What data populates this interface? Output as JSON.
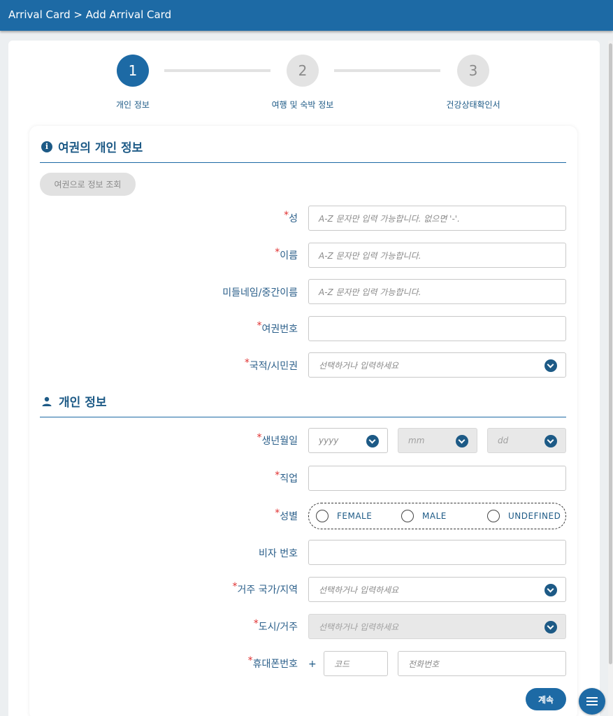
{
  "header": {
    "breadcrumb": "Arrival Card > Add Arrival Card"
  },
  "stepper": {
    "steps": [
      {
        "number": "1",
        "label": "개인 정보",
        "active": true
      },
      {
        "number": "2",
        "label": "여행 및 숙박 정보",
        "active": false
      },
      {
        "number": "3",
        "label": "건강상태확인서",
        "active": false
      }
    ]
  },
  "passport_section": {
    "title": "여권의 개인 정보",
    "icon": "info-icon",
    "lookup_button": "여권으로 정보 조회",
    "fields": {
      "surname": {
        "label": "성",
        "placeholder": "A-Z 문자만 입력 가능합니다. 없으면 '-'.",
        "required": true
      },
      "given_name": {
        "label": "이름",
        "placeholder": "A-Z 문자만 입력 가능합니다.",
        "required": true
      },
      "middle_name": {
        "label": "미들네임/중간이름",
        "placeholder": "A-Z 문자만 입력 가능합니다.",
        "required": false
      },
      "passport_number": {
        "label": "여권번호",
        "placeholder": "",
        "required": true
      },
      "nationality": {
        "label": "국적/시민권",
        "placeholder": "선택하거나 입력하세요",
        "required": true
      }
    }
  },
  "personal_section": {
    "title": "개인 정보",
    "icon": "person-icon",
    "fields": {
      "dob": {
        "label": "생년월일",
        "year": "yyyy",
        "month": "mm",
        "day": "dd",
        "required": true
      },
      "occupation": {
        "label": "직업",
        "placeholder": "",
        "required": true
      },
      "gender": {
        "label": "성별",
        "options": [
          "FEMALE",
          "MALE",
          "UNDEFINED"
        ],
        "required": true
      },
      "visa_number": {
        "label": "비자 번호",
        "placeholder": "",
        "required": false
      },
      "country_of_residence": {
        "label": "거주 국가/지역",
        "placeholder": "선택하거나 입력하세요",
        "required": true
      },
      "city": {
        "label": "도시/거주",
        "placeholder": "선택하거나 입력하세요",
        "required": true
      },
      "mobile": {
        "label": "휴대폰번호",
        "plus": "+",
        "code_placeholder": "코드",
        "phone_placeholder": "전화번호",
        "required": true
      }
    }
  },
  "actions": {
    "continue": "계속"
  },
  "colors": {
    "primary": "#1d6aa5",
    "required": "#e03131"
  }
}
